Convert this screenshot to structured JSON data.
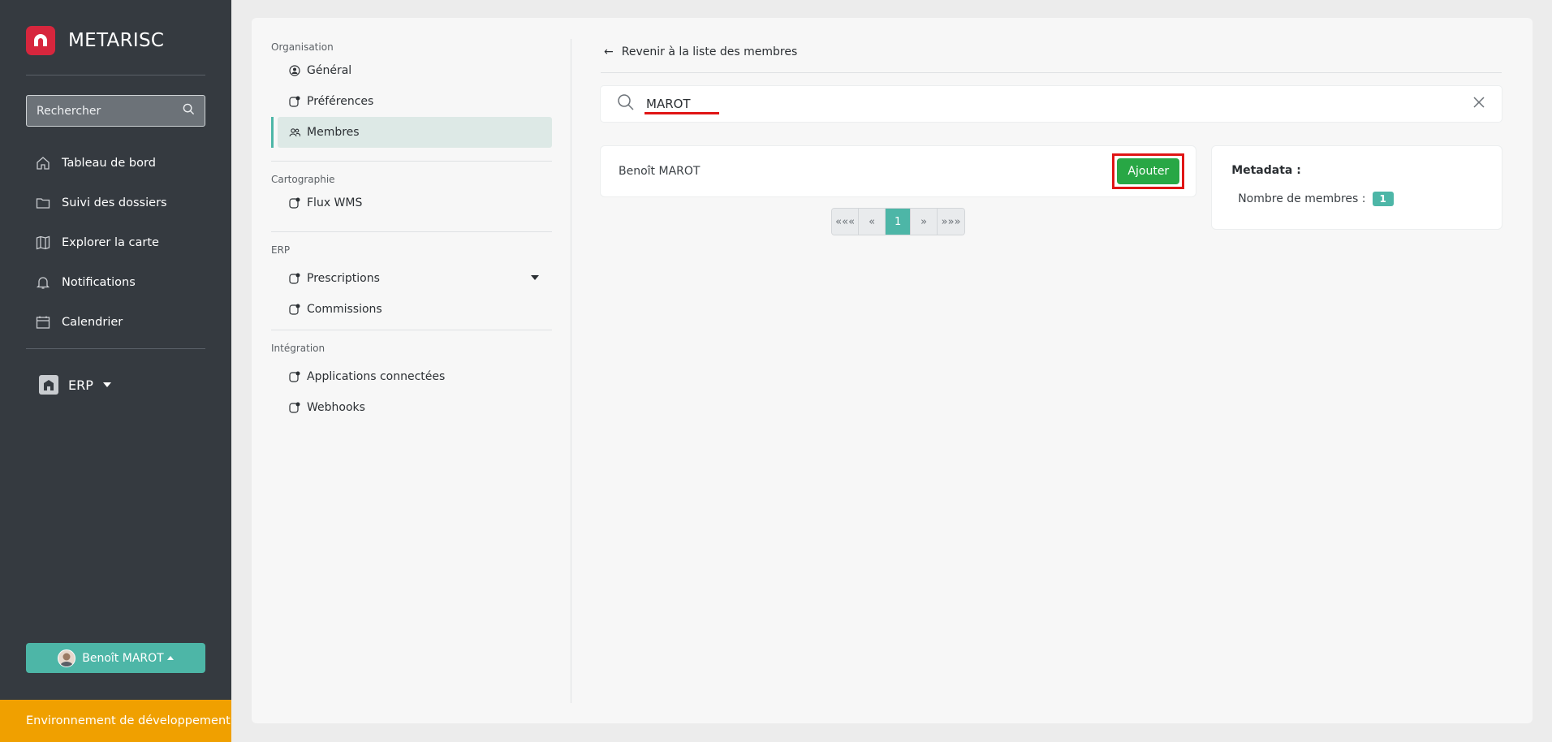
{
  "brand": {
    "name": "METARISC",
    "logo_color": "#d7263d"
  },
  "sidebar": {
    "search_placeholder": "Rechercher",
    "items": [
      {
        "label": "Tableau de bord",
        "icon": "home-icon"
      },
      {
        "label": "Suivi des dossiers",
        "icon": "folder-icon"
      },
      {
        "label": "Explorer la carte",
        "icon": "map-icon"
      },
      {
        "label": "Notifications",
        "icon": "bell-icon"
      },
      {
        "label": "Calendrier",
        "icon": "calendar-icon"
      }
    ],
    "context_selector": "ERP",
    "user": "Benoît MAROT",
    "environment": "Environnement de développement"
  },
  "settings_nav": {
    "sections": [
      {
        "title": "Organisation",
        "items": [
          "Général",
          "Préférences",
          "Membres"
        ]
      },
      {
        "title": "Cartographie",
        "items": [
          "Flux WMS"
        ]
      },
      {
        "title": "ERP",
        "items": [
          "Prescriptions",
          "Commissions"
        ]
      },
      {
        "title": "Intégration",
        "items": [
          "Applications connectées",
          "Webhooks"
        ]
      }
    ],
    "active": "Membres"
  },
  "content": {
    "back_label": "Revenir à la liste des membres",
    "search_value": "MAROT",
    "results": [
      {
        "name": "Benoît MAROT",
        "action": "Ajouter"
      }
    ],
    "pagination": {
      "first": "«««",
      "prev": "«",
      "current": "1",
      "next": "»",
      "last": "»»»"
    },
    "metadata": {
      "title": "Metadata :",
      "members_label": "Nombre de membres :",
      "members_count": "1"
    }
  },
  "colors": {
    "accent": "#4db6a7",
    "success": "#28a745",
    "highlight": "#e01515",
    "env": "#f0a000"
  }
}
